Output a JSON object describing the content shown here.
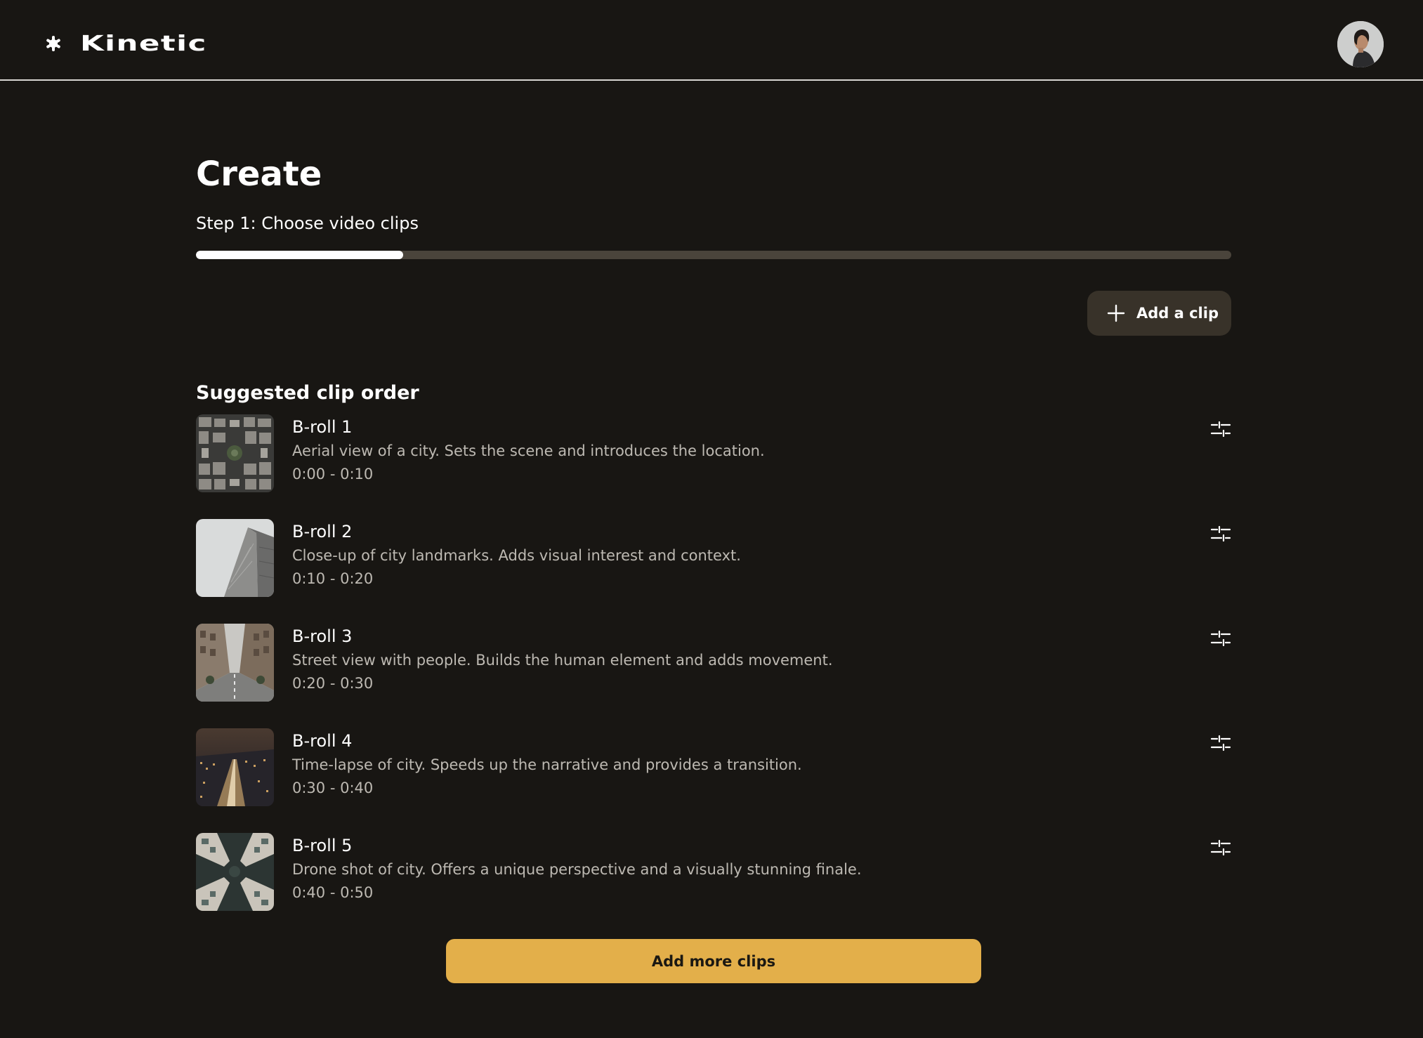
{
  "app": {
    "brand_name": "Kinetic",
    "brand_icon": "asterisk-icon",
    "avatar_icon": "user-avatar"
  },
  "page": {
    "title": "Create",
    "step_label": "Step 1: Choose video clips",
    "progress_fraction": 0.2
  },
  "actions": {
    "add_clip_label": "Add a clip",
    "add_clip_icon": "plus-icon",
    "add_more_label": "Add more clips"
  },
  "section": {
    "title": "Suggested clip order"
  },
  "clips": [
    {
      "name": "B-roll 1",
      "description": "Aerial view of a city. Sets the scene and introduces the location.",
      "time": "0:00 - 0:10",
      "thumb_icon": "aerial-city-thumbnail"
    },
    {
      "name": "B-roll 2",
      "description": "Close-up of city landmarks. Adds visual interest and context.",
      "time": "0:10 - 0:20",
      "thumb_icon": "building-closeup-thumbnail"
    },
    {
      "name": "B-roll 3",
      "description": "Street view with people. Builds the human element and adds movement.",
      "time": "0:20 - 0:30",
      "thumb_icon": "street-view-thumbnail"
    },
    {
      "name": "B-roll 4",
      "description": "Time-lapse of city. Speeds up the narrative and provides a transition.",
      "time": "0:30 - 0:40",
      "thumb_icon": "city-night-thumbnail"
    },
    {
      "name": "B-roll 5",
      "description": "Drone shot of city. Offers a unique perspective and a visually stunning finale.",
      "time": "0:40 - 0:50",
      "thumb_icon": "drone-city-thumbnail"
    }
  ],
  "colors": {
    "background": "#181613",
    "accent": "#e3af4a",
    "secondary_button": "#383229",
    "progress_track": "#4a443b",
    "muted_text": "#bdb9b2"
  }
}
